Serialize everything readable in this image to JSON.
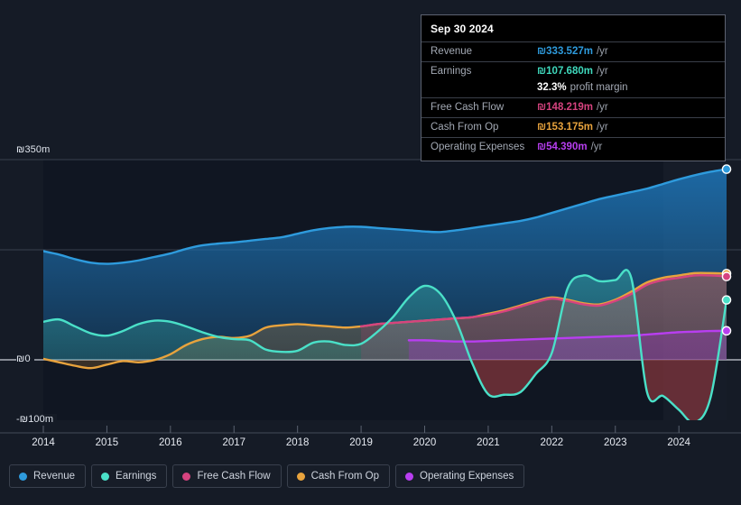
{
  "chart_data": {
    "type": "area",
    "title": "",
    "currency_symbol": "₪",
    "xlabel": "",
    "ylabel": "",
    "x_tick_labels": [
      "2014",
      "2015",
      "2016",
      "2017",
      "2018",
      "2019",
      "2020",
      "2021",
      "2022",
      "2023",
      "2024"
    ],
    "y_tick_labels": [
      "₪350m",
      "₪0",
      "-₪100m"
    ],
    "ylim": [
      -100,
      350
    ],
    "y_ticks": [
      350,
      0,
      -100
    ],
    "grid": true,
    "legend_position": "bottom",
    "zero_line": 0,
    "series": [
      {
        "name": "Revenue",
        "color": "#2e9bdd",
        "end_value": 333.527,
        "x": [
          2014.0,
          2014.25,
          2014.5,
          2014.75,
          2015.0,
          2015.25,
          2015.5,
          2015.75,
          2016.0,
          2016.25,
          2016.5,
          2016.75,
          2017.0,
          2017.25,
          2017.5,
          2017.75,
          2018.0,
          2018.25,
          2018.5,
          2018.75,
          2019.0,
          2019.25,
          2019.5,
          2019.75,
          2020.0,
          2020.25,
          2020.5,
          2020.75,
          2021.0,
          2021.25,
          2021.5,
          2021.75,
          2022.0,
          2022.25,
          2022.5,
          2022.75,
          2023.0,
          2023.25,
          2023.5,
          2023.75,
          2024.0,
          2024.25,
          2024.5,
          2024.75
        ],
        "values": [
          192,
          186,
          178,
          172,
          170,
          172,
          176,
          182,
          188,
          196,
          202,
          205,
          207,
          210,
          213,
          216,
          222,
          228,
          232,
          234,
          234,
          232,
          230,
          228,
          226,
          225,
          228,
          232,
          236,
          240,
          244,
          250,
          258,
          266,
          274,
          282,
          288,
          294,
          300,
          308,
          316,
          323,
          329,
          333.527
        ]
      },
      {
        "name": "Earnings",
        "color": "#4ae0c8",
        "end_value": 107.68,
        "x": [
          2014.0,
          2014.25,
          2014.5,
          2014.75,
          2015.0,
          2015.25,
          2015.5,
          2015.75,
          2016.0,
          2016.25,
          2016.5,
          2016.75,
          2017.0,
          2017.25,
          2017.5,
          2017.75,
          2018.0,
          2018.25,
          2018.5,
          2018.75,
          2019.0,
          2019.25,
          2019.5,
          2019.75,
          2020.0,
          2020.25,
          2020.5,
          2020.75,
          2021.0,
          2021.25,
          2021.5,
          2021.75,
          2022.0,
          2022.25,
          2022.5,
          2022.75,
          2023.0,
          2023.25,
          2023.5,
          2023.75,
          2024.0,
          2024.25,
          2024.5,
          2024.75
        ],
        "values": [
          70,
          74,
          62,
          50,
          46,
          54,
          66,
          72,
          70,
          62,
          52,
          44,
          40,
          38,
          22,
          18,
          20,
          34,
          36,
          30,
          32,
          52,
          78,
          112,
          132,
          118,
          70,
          -2,
          -55,
          -56,
          -52,
          -20,
          16,
          128,
          150,
          140,
          142,
          146,
          -52,
          -58,
          -82,
          -104,
          -60,
          107.68
        ]
      },
      {
        "name": "Free Cash Flow",
        "color": "#d6437f",
        "end_value": 148.219,
        "x": [
          2019.0,
          2019.25,
          2019.5,
          2019.75,
          2020.0,
          2020.25,
          2020.5,
          2020.75,
          2021.0,
          2021.25,
          2021.5,
          2021.75,
          2022.0,
          2022.25,
          2022.5,
          2022.75,
          2023.0,
          2023.25,
          2023.5,
          2023.75,
          2024.0,
          2024.25,
          2024.5,
          2024.75
        ],
        "values": [
          62,
          66,
          68,
          70,
          72,
          74,
          76,
          78,
          82,
          88,
          96,
          104,
          110,
          106,
          100,
          98,
          106,
          118,
          134,
          142,
          146,
          150,
          150,
          148.219
        ]
      },
      {
        "name": "Cash From Op",
        "color": "#e8a33d",
        "end_value": 153.175,
        "x": [
          2014.0,
          2014.25,
          2014.5,
          2014.75,
          2015.0,
          2015.25,
          2015.5,
          2015.75,
          2016.0,
          2016.25,
          2016.5,
          2016.75,
          2017.0,
          2017.25,
          2017.5,
          2017.75,
          2018.0,
          2018.25,
          2018.5,
          2018.75,
          2019.0,
          2019.25,
          2019.5,
          2019.75,
          2020.0,
          2020.25,
          2020.5,
          2020.75,
          2021.0,
          2021.25,
          2021.5,
          2021.75,
          2022.0,
          2022.25,
          2022.5,
          2022.75,
          2023.0,
          2023.25,
          2023.5,
          2023.75,
          2024.0,
          2024.25,
          2024.5,
          2024.75
        ],
        "values": [
          6,
          0,
          -6,
          -10,
          -4,
          2,
          0,
          4,
          14,
          30,
          40,
          44,
          42,
          46,
          60,
          64,
          66,
          64,
          62,
          60,
          62,
          66,
          68,
          70,
          72,
          74,
          76,
          78,
          84,
          90,
          98,
          106,
          112,
          108,
          102,
          100,
          108,
          122,
          138,
          146,
          150,
          154,
          154,
          153.175
        ]
      },
      {
        "name": "Operating Expenses",
        "color": "#b83ef0",
        "end_value": 54.39,
        "x": [
          2019.75,
          2020.0,
          2020.25,
          2020.5,
          2020.75,
          2021.0,
          2021.25,
          2021.5,
          2021.75,
          2022.0,
          2022.25,
          2022.5,
          2022.75,
          2023.0,
          2023.25,
          2023.5,
          2023.75,
          2024.0,
          2024.25,
          2024.5,
          2024.75
        ],
        "values": [
          38,
          38,
          37,
          36,
          36,
          37,
          38,
          39,
          40,
          41,
          42,
          43,
          44,
          45,
          46,
          48,
          50,
          52,
          53,
          54,
          54.39
        ]
      }
    ]
  },
  "tooltip": {
    "date": "Sep 30 2024",
    "rows": [
      {
        "label": "Revenue",
        "value": "₪333.527m",
        "unit": "/yr",
        "color": "#2e9bdd"
      },
      {
        "label": "Earnings",
        "value": "₪107.680m",
        "unit": "/yr",
        "color": "#3fd9bd"
      },
      {
        "label": "",
        "value": "32.3%",
        "unit": "profit margin",
        "color": "#ffffff",
        "is_margin": true
      },
      {
        "label": "Free Cash Flow",
        "value": "₪148.219m",
        "unit": "/yr",
        "color": "#d6437f"
      },
      {
        "label": "Cash From Op",
        "value": "₪153.175m",
        "unit": "/yr",
        "color": "#e8a33d"
      },
      {
        "label": "Operating Expenses",
        "value": "₪54.390m",
        "unit": "/yr",
        "color": "#b83ef0"
      }
    ]
  },
  "legend": {
    "items": [
      {
        "label": "Revenue",
        "color": "#2e9bdd"
      },
      {
        "label": "Earnings",
        "color": "#4ae0c8"
      },
      {
        "label": "Free Cash Flow",
        "color": "#d6437f"
      },
      {
        "label": "Cash From Op",
        "color": "#e8a33d"
      },
      {
        "label": "Operating Expenses",
        "color": "#b83ef0"
      }
    ]
  }
}
